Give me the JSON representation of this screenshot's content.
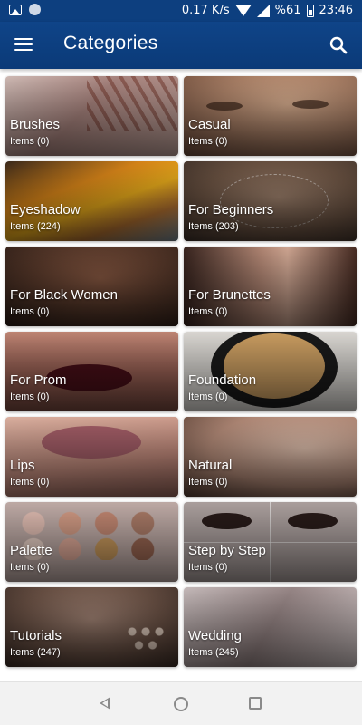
{
  "status_bar": {
    "network_speed": "0.17 K/s",
    "battery": "%61",
    "time": "23:46"
  },
  "app_bar": {
    "title": "Categories",
    "menu_icon": "hamburger-menu-icon",
    "search_icon": "search-icon"
  },
  "categories": [
    {
      "name": "Brushes",
      "count": "Items (0)",
      "bg": "#a88a86"
    },
    {
      "name": "Casual",
      "count": "Items (0)",
      "bg": "#b58c72"
    },
    {
      "name": "Eyeshadow",
      "count": "Items (224)",
      "bg": "#c8721e"
    },
    {
      "name": "For Beginners",
      "count": "Items (203)",
      "bg": "#7d6858"
    },
    {
      "name": "For Black Women",
      "count": "Items (0)",
      "bg": "#5a3f33"
    },
    {
      "name": "For Brunettes",
      "count": "Items (0)",
      "bg": "#7a5a4c"
    },
    {
      "name": "For Prom",
      "count": "Items (0)",
      "bg": "#6e3a3a"
    },
    {
      "name": "Foundation",
      "count": "Items (0)",
      "bg": "#b89a62"
    },
    {
      "name": "Lips",
      "count": "Items (0)",
      "bg": "#a9756c"
    },
    {
      "name": "Natural",
      "count": "Items (0)",
      "bg": "#a58676"
    },
    {
      "name": "Palette",
      "count": "Items (0)",
      "bg": "#8e7470"
    },
    {
      "name": "Step by Step",
      "count": "Items (0)",
      "bg": "#6c6262"
    },
    {
      "name": "Tutorials",
      "count": "Items (247)",
      "bg": "#6f5b52"
    },
    {
      "name": "Wedding",
      "count": "Items (245)",
      "bg": "#a89a9a"
    }
  ],
  "nav_bar": {
    "back_icon": "back-triangle-icon",
    "home_icon": "home-circle-icon",
    "recent_icon": "recent-apps-square-icon"
  },
  "colors": {
    "app_bar": "#0d3f7f",
    "nav_bar": "#f2f2f2"
  }
}
